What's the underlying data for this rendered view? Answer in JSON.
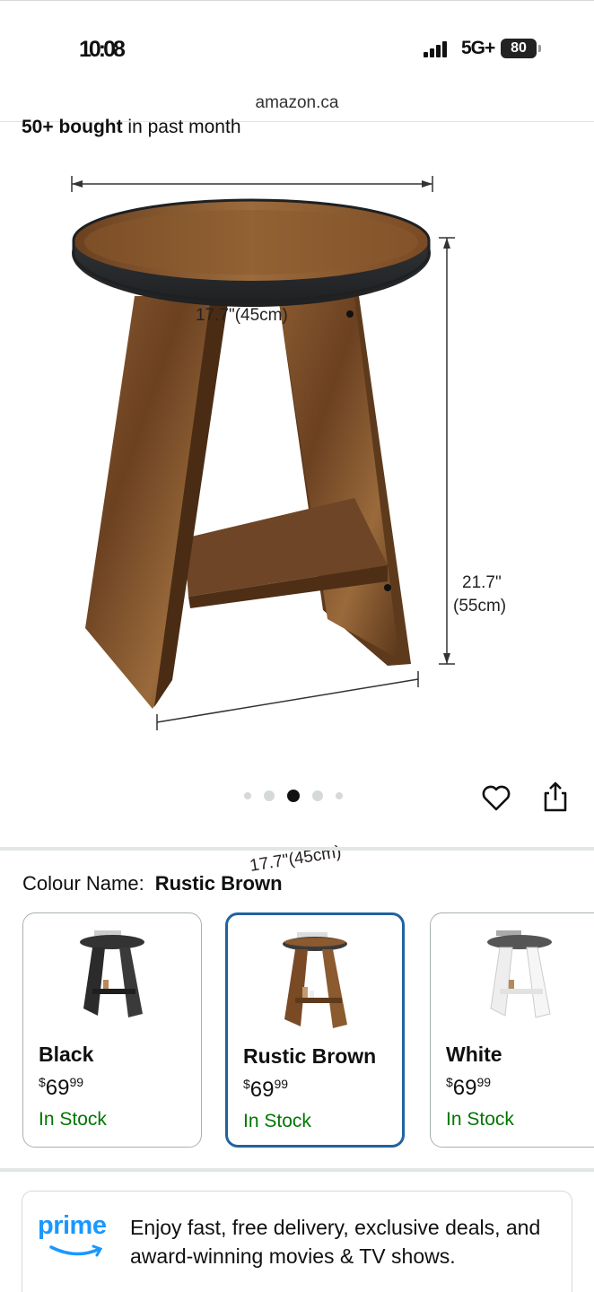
{
  "status": {
    "time": "10:08",
    "network": "5G+",
    "battery": "80"
  },
  "url": "amazon.ca",
  "bought": {
    "bold": "50+ bought",
    "rest": " in past month"
  },
  "dimensions": {
    "top_width": "17.7\"(45cm)",
    "height_in": "21.7\"",
    "height_cm": "(55cm)",
    "base_width": "17.7\"(45cm)"
  },
  "gallery": {
    "dot_count": 5,
    "active_index": 2
  },
  "colour": {
    "label": "Colour Name:",
    "value": "Rustic Brown"
  },
  "swatches": [
    {
      "name": "Black",
      "currency": "$",
      "price_whole": "69",
      "price_frac": "99",
      "stock": "In Stock",
      "selected": false,
      "color": "#2b2b2b"
    },
    {
      "name": "Rustic Brown",
      "currency": "$",
      "price_whole": "69",
      "price_frac": "99",
      "stock": "In Stock",
      "selected": true,
      "color": "#7a4a25"
    },
    {
      "name": "White",
      "currency": "$",
      "price_whole": "69",
      "price_frac": "99",
      "stock": "In Stock",
      "selected": false,
      "color": "#f2f2f2"
    }
  ],
  "prime": {
    "logo": "prime",
    "text": "Enjoy fast, free delivery, exclusive deals, and award-winning movies & TV shows."
  },
  "colors": {
    "accent_blue": "#2162a1",
    "stock_green": "#007600",
    "prime_blue": "#1a98ff"
  }
}
